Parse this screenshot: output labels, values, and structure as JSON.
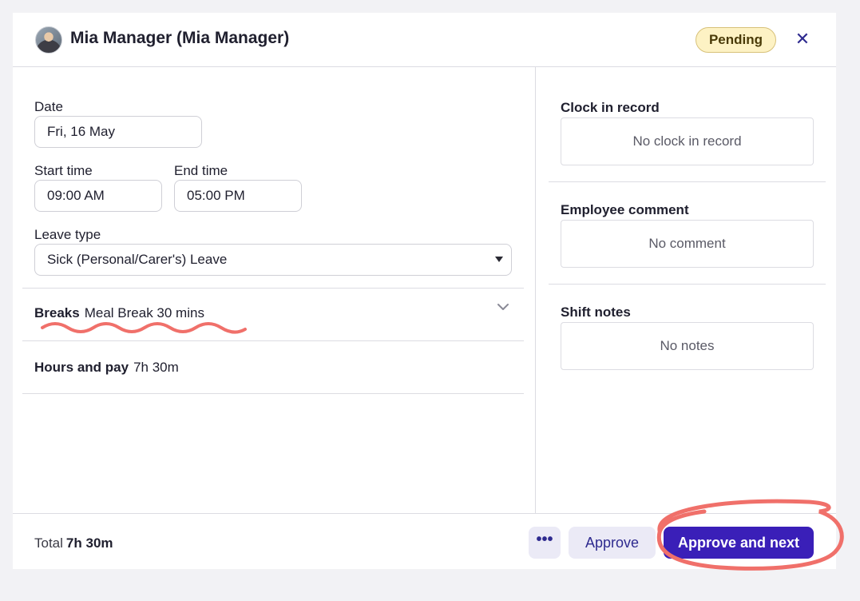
{
  "header": {
    "title": "Mia Manager (Mia Manager)",
    "status": "Pending",
    "close_glyph": "✕",
    "avatar_icon": "user-avatar"
  },
  "form": {
    "date_label": "Date",
    "date_value": "Fri, 16 May",
    "start_label": "Start time",
    "start_value": "09:00 AM",
    "end_label": "End time",
    "end_value": "05:00 PM",
    "leave_label": "Leave type",
    "leave_value": "Sick (Personal/Carer's) Leave"
  },
  "breaks": {
    "label": "Breaks",
    "value": "Meal Break 30 mins"
  },
  "hours": {
    "label": "Hours and pay",
    "value": "7h 30m"
  },
  "side": {
    "clock_label": "Clock in record",
    "clock_value": "No clock in record",
    "comment_label": "Employee comment",
    "comment_value": "No comment",
    "notes_label": "Shift notes",
    "notes_value": "No notes"
  },
  "footer": {
    "total_label": "Total",
    "total_value": "7h 30m",
    "more_glyph": "•••",
    "approve_label": "Approve",
    "next_label": "Approve and next"
  },
  "colors": {
    "accent": "#3a1fb8",
    "annotation": "#f0706a",
    "badge_bg": "#fdf2c4"
  }
}
